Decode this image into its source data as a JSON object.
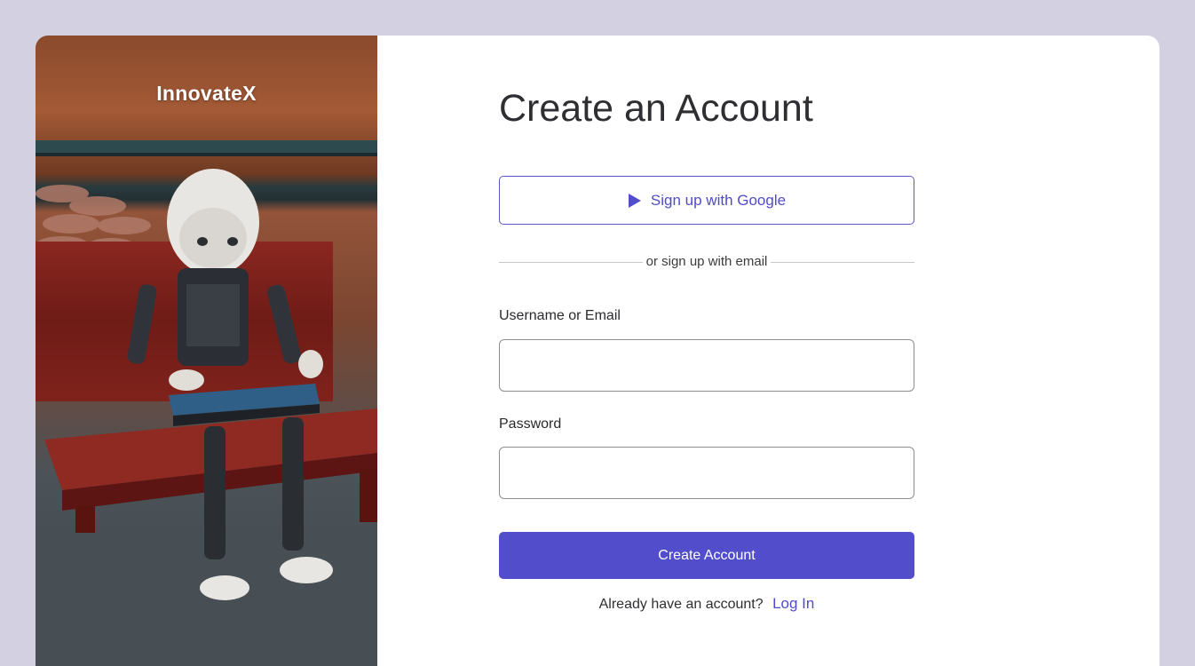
{
  "brand": {
    "name": "InnovateX"
  },
  "form": {
    "title": "Create an Account",
    "google_label": "Sign up with Google",
    "divider_text": "or sign up with email",
    "username_label": "Username or Email",
    "username_value": "",
    "password_label": "Password",
    "password_value": "",
    "submit_label": "Create Account",
    "login_prompt": "Already have an account?",
    "login_link": "Log In"
  },
  "icons": {
    "google_button_icon": "play-icon"
  },
  "colors": {
    "accent": "#524ecb",
    "background": "#d3d1e1",
    "card": "#ffffff",
    "title_text": "#2f2f33"
  }
}
